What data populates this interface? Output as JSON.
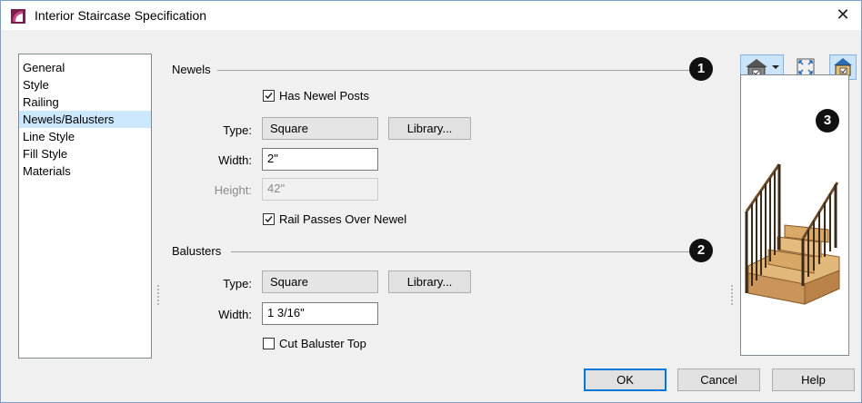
{
  "window": {
    "title": "Interior Staircase Specification"
  },
  "nav": {
    "items": [
      "General",
      "Style",
      "Railing",
      "Newels/Balusters",
      "Line Style",
      "Fill Style",
      "Materials"
    ],
    "selected_index": 3
  },
  "newels": {
    "section_label": "Newels",
    "badge": "1",
    "has_newel_posts": {
      "label": "Has Newel Posts",
      "checked": true
    },
    "type": {
      "label": "Type:",
      "value": "Square"
    },
    "library_label": "Library...",
    "width": {
      "label": "Width:",
      "value": "2\""
    },
    "height": {
      "label": "Height:",
      "value": "42\""
    },
    "rail_passes": {
      "label": "Rail Passes Over Newel",
      "checked": true
    }
  },
  "balusters": {
    "section_label": "Balusters",
    "badge": "2",
    "type": {
      "label": "Type:",
      "value": "Square"
    },
    "library_label": "Library...",
    "width": {
      "label": "Width:",
      "value": "1 3/16\""
    },
    "cut_top": {
      "label": "Cut Baluster Top",
      "checked": false
    }
  },
  "preview": {
    "badge": "3"
  },
  "buttons": {
    "ok": "OK",
    "cancel": "Cancel",
    "help": "Help"
  },
  "icons": {
    "app": "app-icon",
    "close": "close-icon",
    "view": "house-view-icon",
    "fit": "fit-view-icon",
    "options": "preview-options-icon"
  },
  "colors": {
    "selection": "#cce8ff",
    "accent": "#0078d7",
    "app_icon": "#7a1e4a"
  }
}
